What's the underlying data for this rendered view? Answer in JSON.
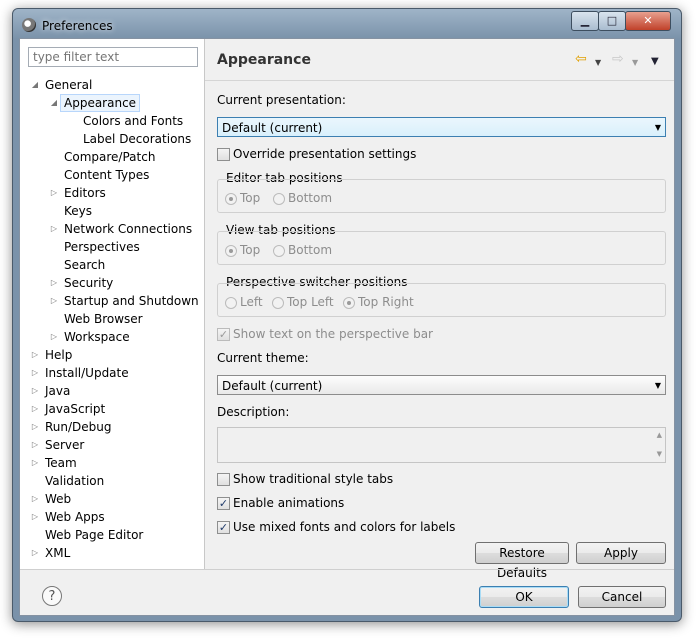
{
  "window": {
    "title": "Preferences"
  },
  "filter": {
    "placeholder": "type filter text"
  },
  "tree": [
    {
      "label": "General",
      "level": 0,
      "arrow": "expanded"
    },
    {
      "label": "Appearance",
      "level": 1,
      "arrow": "expanded",
      "selected": true
    },
    {
      "label": "Colors and Fonts",
      "level": 2,
      "arrow": "none"
    },
    {
      "label": "Label Decorations",
      "level": 2,
      "arrow": "none"
    },
    {
      "label": "Compare/Patch",
      "level": 1,
      "arrow": "none"
    },
    {
      "label": "Content Types",
      "level": 1,
      "arrow": "none"
    },
    {
      "label": "Editors",
      "level": 1,
      "arrow": "collapsed"
    },
    {
      "label": "Keys",
      "level": 1,
      "arrow": "none"
    },
    {
      "label": "Network Connections",
      "level": 1,
      "arrow": "collapsed"
    },
    {
      "label": "Perspectives",
      "level": 1,
      "arrow": "none"
    },
    {
      "label": "Search",
      "level": 1,
      "arrow": "none"
    },
    {
      "label": "Security",
      "level": 1,
      "arrow": "collapsed"
    },
    {
      "label": "Startup and Shutdown",
      "level": 1,
      "arrow": "collapsed"
    },
    {
      "label": "Web Browser",
      "level": 1,
      "arrow": "none"
    },
    {
      "label": "Workspace",
      "level": 1,
      "arrow": "collapsed"
    },
    {
      "label": "Help",
      "level": 0,
      "arrow": "collapsed"
    },
    {
      "label": "Install/Update",
      "level": 0,
      "arrow": "collapsed"
    },
    {
      "label": "Java",
      "level": 0,
      "arrow": "collapsed"
    },
    {
      "label": "JavaScript",
      "level": 0,
      "arrow": "collapsed"
    },
    {
      "label": "Run/Debug",
      "level": 0,
      "arrow": "collapsed"
    },
    {
      "label": "Server",
      "level": 0,
      "arrow": "collapsed"
    },
    {
      "label": "Team",
      "level": 0,
      "arrow": "collapsed"
    },
    {
      "label": "Validation",
      "level": 0,
      "arrow": "none"
    },
    {
      "label": "Web",
      "level": 0,
      "arrow": "collapsed"
    },
    {
      "label": "Web Apps",
      "level": 0,
      "arrow": "collapsed"
    },
    {
      "label": "Web Page Editor",
      "level": 0,
      "arrow": "none"
    },
    {
      "label": "XML",
      "level": 0,
      "arrow": "collapsed"
    }
  ],
  "page": {
    "title": "Appearance",
    "current_presentation_label": "Current presentation:",
    "current_presentation_value": "Default (current)",
    "override_label": "Override presentation settings",
    "editor_tab": {
      "title": "Editor tab positions",
      "options": [
        "Top",
        "Bottom"
      ],
      "selected": "Top"
    },
    "view_tab": {
      "title": "View tab positions",
      "options": [
        "Top",
        "Bottom"
      ],
      "selected": "Top"
    },
    "perspective_switcher": {
      "title": "Perspective switcher positions",
      "options": [
        "Left",
        "Top Left",
        "Top Right"
      ],
      "selected": "Top Right"
    },
    "show_text_label": "Show text on the perspective bar",
    "current_theme_label": "Current theme:",
    "current_theme_value": "Default (current)",
    "description_label": "Description:",
    "traditional_tabs_label": "Show traditional style tabs",
    "enable_animations_label": "Enable animations",
    "mixed_fonts_label": "Use mixed fonts and colors for labels",
    "restore_defaults": "Restore Defaults",
    "apply": "Apply"
  },
  "dialog": {
    "ok": "OK",
    "cancel": "Cancel"
  },
  "checks": {
    "override": false,
    "show_text": true,
    "traditional": false,
    "animations": true,
    "mixed_fonts": true
  },
  "colors": {
    "accent": "#3c7fb1",
    "selection": "#ebf4fd",
    "titlebar": "#7a92aa"
  }
}
